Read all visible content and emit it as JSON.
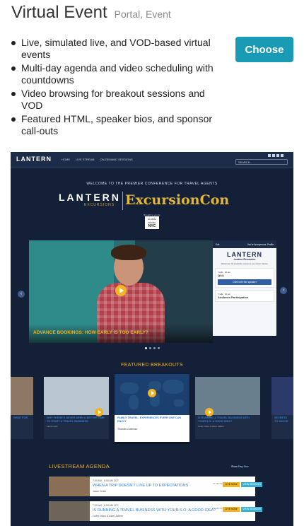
{
  "header": {
    "title": "Virtual Event",
    "subtitle": "Portal, Event"
  },
  "features": [
    "Live, simulated live, and VOD-based virtual events",
    "Multi-day agenda and video scheduling with countdowns",
    "Video browsing for breakout sessions and VOD",
    "Featured HTML, speaker bios, and sponsor call-outs"
  ],
  "choose_label": "Choose",
  "preview": {
    "logo": "LANTERN",
    "nav": [
      "HOME",
      "LIVE STREAM",
      "ON-DEMAND SESSIONS"
    ],
    "search_placeholder": "SEARCH...",
    "welcome": "WELCOME TO THE PREMIER CONFERENCE FOR TRAVEL AGENTS",
    "brand_logo": "LANTERN",
    "brand_sub": "EXCURSIONS",
    "event_title": "ExcursionCon",
    "brought_by": "Brought to you by",
    "sponsor_top": "GLOBAL TRAVEL",
    "sponsor_bottom": "NYC",
    "hero_caption": "ADVANCE BOOKINGS: HOW EARLY IS TOO EARLY?",
    "side_panel": {
      "exit": "Exit",
      "user": "You're Anonymous. Profile",
      "logo": "LANTERN",
      "name": "Lantern Excursion",
      "note": "Welcome! All available sessions are shown below.",
      "card1_time": "7 talk · 10 am",
      "card1_title": "Q&A",
      "card1_button": "Chat with the speaker",
      "card2_time": "7 talk · 10 am",
      "card2_title": "Audience Participation"
    },
    "featured_title": "FEATURED BREAKOUTS",
    "breakouts": [
      {
        "title": "WHAT FOR",
        "meta": ""
      },
      {
        "title": "WHY THERE'S NEVER BEEN A BETTER TIME TO START A TRAVEL BUSINESS",
        "meta": "Laura Lavin"
      },
      {
        "title": "FAMILY TRAVEL: EXPERIENCES EVERYONE CAN ENJOY",
        "meta": "Thomas Coleman"
      },
      {
        "title": "IS RUNNING A TRAVEL BUSINESS WITH YOUR S.O. A GOOD IDEA?",
        "meta": "Colby Olsen & Aster Jabber"
      },
      {
        "title": "SECRETS TO SUCCE",
        "meta": ""
      }
    ],
    "agenda_title": "LIVESTREAM AGENDA",
    "agenda_show_label": "Show",
    "agenda_show_value": "Day One",
    "agenda": [
      {
        "time": "7:00 AM - 8:00 AM CDT",
        "title": "WHEN A TRIP DOESN'T LIVE UP TO EXPECTATIONS",
        "speaker": "Jason Smith",
        "tz": "IN SESSION",
        "live": "LIVE NOW",
        "view": "VIEW SESSION"
      },
      {
        "time": "7:00 AM - 8:00 AM CDT",
        "title": "IS RUNNING A TRAVEL BUSINESS WITH YOUR S.O. A GOOD IDEA?",
        "speaker": "Colby Olsen & Aster Jabber",
        "tz": "IN SESSION",
        "live": "LIVE NOW",
        "view": "VIEW SESSION"
      }
    ]
  },
  "colors": {
    "accent": "#1a9bb5",
    "gold": "#f2b425",
    "navy": "#142038"
  }
}
